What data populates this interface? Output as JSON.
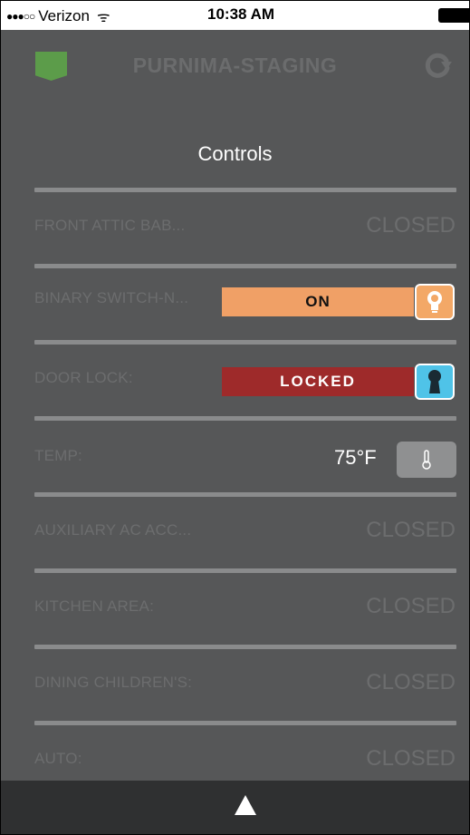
{
  "status_bar": {
    "signal": "●●●○○",
    "carrier": "Verizon",
    "wifi": "ᯤ",
    "time": "10:38 AM"
  },
  "nav": {
    "title": "PURNIMA-STAGING",
    "left_icon": "shield-icon",
    "right_icon": "refresh-icon"
  },
  "section": {
    "title": "Controls"
  },
  "rows": [
    {
      "label": "FRONT ATTIC BAB...",
      "status": "CLOSED"
    },
    {
      "label": "BINARY SWITCH-N...",
      "control": "ON",
      "icon": "bulb-icon"
    },
    {
      "label": "DOOR LOCK:",
      "control": "LOCKED",
      "icon": "keyhole-icon"
    },
    {
      "label": "TEMP:",
      "value": "75°F",
      "icon": "thermometer-icon"
    },
    {
      "label": "AUXILIARY AC ACC...",
      "status": "CLOSED"
    },
    {
      "label": "KITCHEN AREA:",
      "status": "CLOSED"
    },
    {
      "label": "DINING CHILDREN'S:",
      "status": "CLOSED"
    },
    {
      "label": "AUTO:",
      "status": "CLOSED"
    }
  ],
  "colors": {
    "background": "#565758",
    "on_bar": "#f0a066",
    "locked_bar": "#9e2a2a",
    "lock_button": "#4fc3e8",
    "shield": "#5c9c4a"
  },
  "bottom_bar": {
    "icon": "up-arrow-icon"
  }
}
